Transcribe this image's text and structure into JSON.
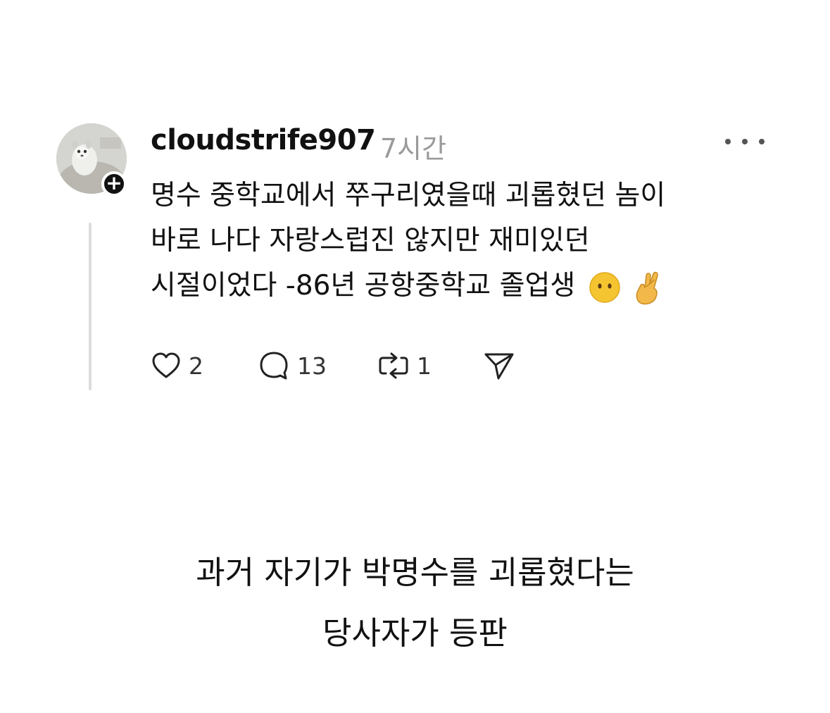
{
  "post": {
    "username": "cloudstrife907",
    "timestamp": "7시간",
    "follow_symbol": "+",
    "body_lines": [
      "명수 중학교에서 쭈구리였을때 괴롭혔던 놈이",
      "바로 나다 자랑스럽진 않지만 재미있던",
      "시절이었다 -86년 공항중학교 졸업생"
    ],
    "emojis": [
      "face-without-mouth-emoji",
      "crossed-fingers-emoji"
    ],
    "actions": {
      "like_count": "2",
      "comment_count": "13",
      "repost_count": "1"
    },
    "icons": {
      "like": "heart-icon",
      "comment": "comment-bubble-icon",
      "repost": "repost-icon",
      "share": "send-icon",
      "more": "more-dots-icon"
    }
  },
  "caption": {
    "line1": "과거 자기가 박명수를 괴롭혔다는",
    "line2": "당사자가 등판"
  },
  "colors": {
    "text": "#111111",
    "muted": "#9a9a9a",
    "thread_line": "#dcdcdc",
    "emoji_yellow": "#f5c431"
  }
}
